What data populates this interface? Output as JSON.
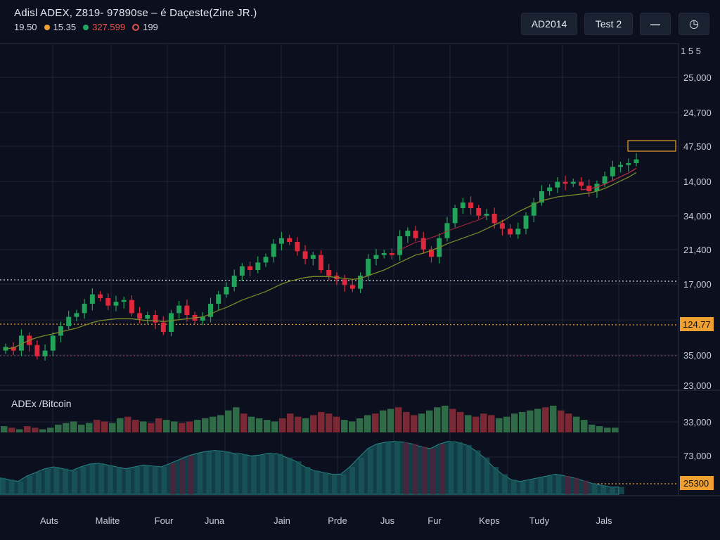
{
  "header": {
    "title": "Adisl ADEX,  Z819- 97890se – é Daçeste(Zine JR.)",
    "stats": [
      {
        "text": "19.50",
        "marker": "none",
        "color": "#d7dbe6"
      },
      {
        "text": "15.35",
        "marker": "dot",
        "color": "#f0a030"
      },
      {
        "text": "327.599",
        "marker": "dot",
        "color": "#22a860",
        "text_color": "#e8554a"
      },
      {
        "text": "199",
        "marker": "ring",
        "color": "#e05050"
      }
    ],
    "buttons": {
      "ad": "AD2014",
      "test": "Test 2",
      "minimize": "—",
      "clock": "◷"
    }
  },
  "colors": {
    "background": "#0b0f1e",
    "up": "#21a35a",
    "down": "#e0283c",
    "ma": "#7a8a2a",
    "orange": "#f0a030",
    "grid": "#1e2638"
  },
  "chart_data": [
    {
      "type": "candlestick",
      "title": "",
      "y_ticks": [
        "25,000",
        "24,700",
        "47,500",
        "14,000",
        "34,000",
        "21,400",
        "17,000",
        "35,000",
        "23,000"
      ],
      "x_ticks": [
        "Auts",
        "Malite",
        "Four",
        "Juna",
        "Jain",
        "Prde",
        "Jus",
        "Fur",
        "Keps",
        "Tudy",
        "Jals"
      ],
      "price_label": "124.77",
      "corner_label": "1 5 5",
      "closes": [
        12.0,
        11.6,
        13.2,
        12.2,
        11.0,
        11.6,
        13.2,
        14.2,
        15.2,
        15.6,
        16.6,
        17.6,
        17.2,
        16.4,
        16.8,
        17.0,
        15.6,
        15.0,
        15.4,
        14.6,
        13.6,
        15.6,
        16.4,
        15.4,
        14.8,
        15.2,
        16.6,
        17.6,
        18.4,
        19.6,
        20.6,
        20.2,
        21.0,
        21.6,
        23.0,
        23.6,
        23.2,
        22.2,
        21.4,
        21.8,
        20.2,
        19.6,
        19.2,
        18.6,
        18.2,
        19.6,
        21.4,
        21.8,
        22.0,
        21.8,
        23.8,
        24.4,
        23.6,
        22.4,
        21.6,
        23.6,
        25.2,
        26.8,
        27.4,
        26.8,
        26.0,
        26.2,
        25.2,
        24.6,
        24.0,
        24.6,
        26.0,
        27.4,
        28.6,
        29.0,
        29.6,
        29.4,
        29.6,
        29.2,
        28.6,
        29.4,
        30.2,
        31.2,
        31.4,
        31.6,
        32.0
      ],
      "ma": [
        11.8,
        11.9,
        12.3,
        12.7,
        13.0,
        13.2,
        13.4,
        13.6,
        13.8,
        14.0,
        14.3,
        14.6,
        14.8,
        14.9,
        15.0,
        15.0,
        15.0,
        14.9,
        14.8,
        14.8,
        14.7,
        14.8,
        14.9,
        15.0,
        15.1,
        15.2,
        15.5,
        15.9,
        16.2,
        16.6,
        17.0,
        17.3,
        17.6,
        17.9,
        18.3,
        18.7,
        19.0,
        19.2,
        19.4,
        19.5,
        19.5,
        19.5,
        19.4,
        19.3,
        19.2,
        19.3,
        19.6,
        19.9,
        20.2,
        20.6,
        21.0,
        21.4,
        21.8,
        22.0,
        22.3,
        22.6,
        23.0,
        23.3,
        23.6,
        23.9,
        24.2,
        24.6,
        25.0,
        25.4,
        25.9,
        26.4,
        26.8,
        27.2,
        27.6,
        27.8,
        28.0,
        28.1,
        28.2,
        28.3,
        28.4,
        28.6,
        28.9,
        29.3,
        29.7,
        30.1,
        30.6
      ]
    },
    {
      "type": "bar",
      "title": "ADEx /Bitcoin",
      "y_ticks": [
        "33,000",
        "73,000"
      ],
      "highlight_label": "25300",
      "values": [
        4,
        3,
        2,
        4,
        3,
        2,
        3,
        5,
        6,
        7,
        5,
        6,
        8,
        7,
        6,
        9,
        10,
        8,
        7,
        6,
        9,
        8,
        7,
        6,
        7,
        8,
        9,
        10,
        11,
        14,
        16,
        12,
        10,
        9,
        8,
        7,
        9,
        12,
        10,
        9,
        11,
        13,
        12,
        10,
        8,
        7,
        9,
        11,
        12,
        14,
        15,
        16,
        13,
        11,
        12,
        14,
        16,
        17,
        15,
        13,
        11,
        10,
        12,
        11,
        9,
        10,
        12,
        13,
        14,
        15,
        16,
        17,
        14,
        12,
        10,
        8,
        5,
        4,
        3,
        3
      ]
    },
    {
      "type": "area",
      "title": "",
      "values": [
        18,
        16,
        14,
        20,
        24,
        28,
        30,
        28,
        26,
        30,
        33,
        34,
        32,
        30,
        28,
        30,
        32,
        31,
        30,
        34,
        38,
        42,
        45,
        47,
        48,
        47,
        45,
        44,
        42,
        43,
        45,
        44,
        40,
        36,
        30,
        26,
        24,
        22,
        22,
        30,
        40,
        50,
        55,
        57,
        58,
        57,
        55,
        52,
        50,
        55,
        58,
        57,
        54,
        48,
        40,
        30,
        22,
        16,
        14,
        16,
        18,
        20,
        22,
        20,
        18,
        15,
        12,
        10,
        8,
        8
      ]
    }
  ]
}
